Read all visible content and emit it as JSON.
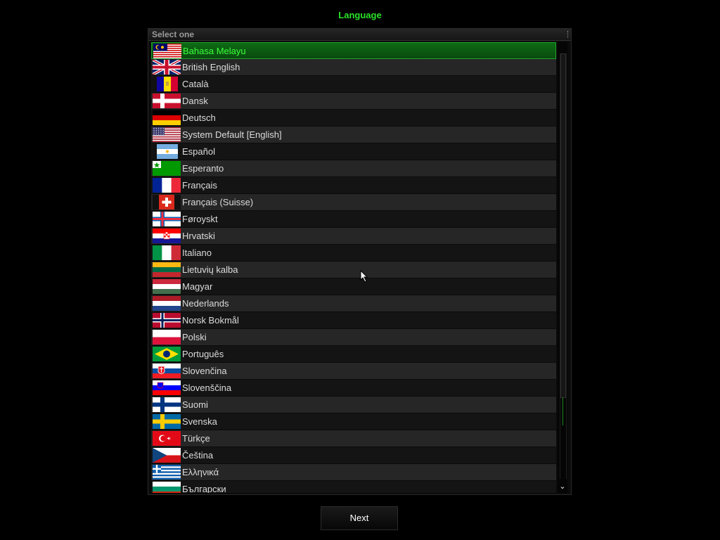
{
  "title": "Language",
  "panel": {
    "header": "Select one"
  },
  "languages": [
    {
      "name": "Bahasa Melayu",
      "flag": "malaysia",
      "selected": true
    },
    {
      "name": "British English",
      "flag": "uk"
    },
    {
      "name": "Català",
      "flag": "andorra"
    },
    {
      "name": "Dansk",
      "flag": "denmark"
    },
    {
      "name": "Deutsch",
      "flag": "germany"
    },
    {
      "name": "System Default [English]",
      "flag": "usa"
    },
    {
      "name": "Español",
      "flag": "argentina"
    },
    {
      "name": "Esperanto",
      "flag": "esperanto"
    },
    {
      "name": "Français",
      "flag": "france"
    },
    {
      "name": "Français (Suisse)",
      "flag": "switzerland"
    },
    {
      "name": "Føroyskt",
      "flag": "faroe"
    },
    {
      "name": "Hrvatski",
      "flag": "croatia"
    },
    {
      "name": "Italiano",
      "flag": "italy"
    },
    {
      "name": "Lietuvių kalba",
      "flag": "lithuania"
    },
    {
      "name": "Magyar",
      "flag": "hungary"
    },
    {
      "name": "Nederlands",
      "flag": "netherlands"
    },
    {
      "name": "Norsk Bokmål",
      "flag": "norway"
    },
    {
      "name": "Polski",
      "flag": "poland"
    },
    {
      "name": "Português",
      "flag": "brazil"
    },
    {
      "name": "Slovenčina",
      "flag": "slovakia"
    },
    {
      "name": "Slovenščina",
      "flag": "slovenia"
    },
    {
      "name": "Suomi",
      "flag": "finland"
    },
    {
      "name": "Svenska",
      "flag": "sweden"
    },
    {
      "name": "Türkçe",
      "flag": "turkey"
    },
    {
      "name": "Čeština",
      "flag": "czech"
    },
    {
      "name": "Ελληνικά",
      "flag": "greece"
    },
    {
      "name": "Български",
      "flag": "bulgaria"
    }
  ],
  "buttons": {
    "next": "Next"
  },
  "colors": {
    "accent": "#2be12b",
    "selected_bg": "#0d6b14"
  }
}
